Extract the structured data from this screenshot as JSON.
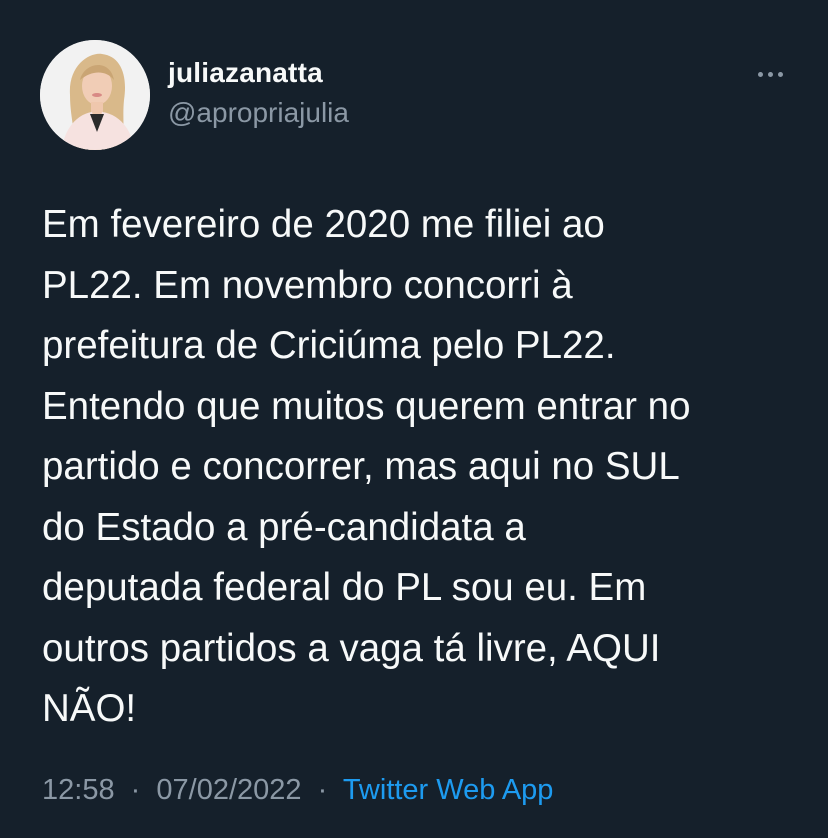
{
  "author": {
    "display_name": "juliazanatta",
    "handle": "@apropriajulia"
  },
  "tweet": {
    "text": "Em fevereiro de 2020 me filiei ao\nPL22. Em novembro concorri à\nprefeitura de Criciúma pelo PL22.\nEntendo que muitos querem entrar no\npartido e concorrer, mas aqui no SUL\ndo Estado a pré-candidata a\ndeputada federal do PL sou eu. Em\noutros partidos a vaga tá livre, AQUI\nNÃO!",
    "time": "12:58",
    "separator": "·",
    "date": "07/02/2022",
    "source": "Twitter Web App"
  },
  "icons": {
    "more": "more-horizontal-icon",
    "avatar": "profile-photo"
  },
  "colors": {
    "background": "#15202b",
    "text_primary": "#f7f9f9",
    "text_secondary": "#8b98a5",
    "link": "#1d9bf0"
  }
}
